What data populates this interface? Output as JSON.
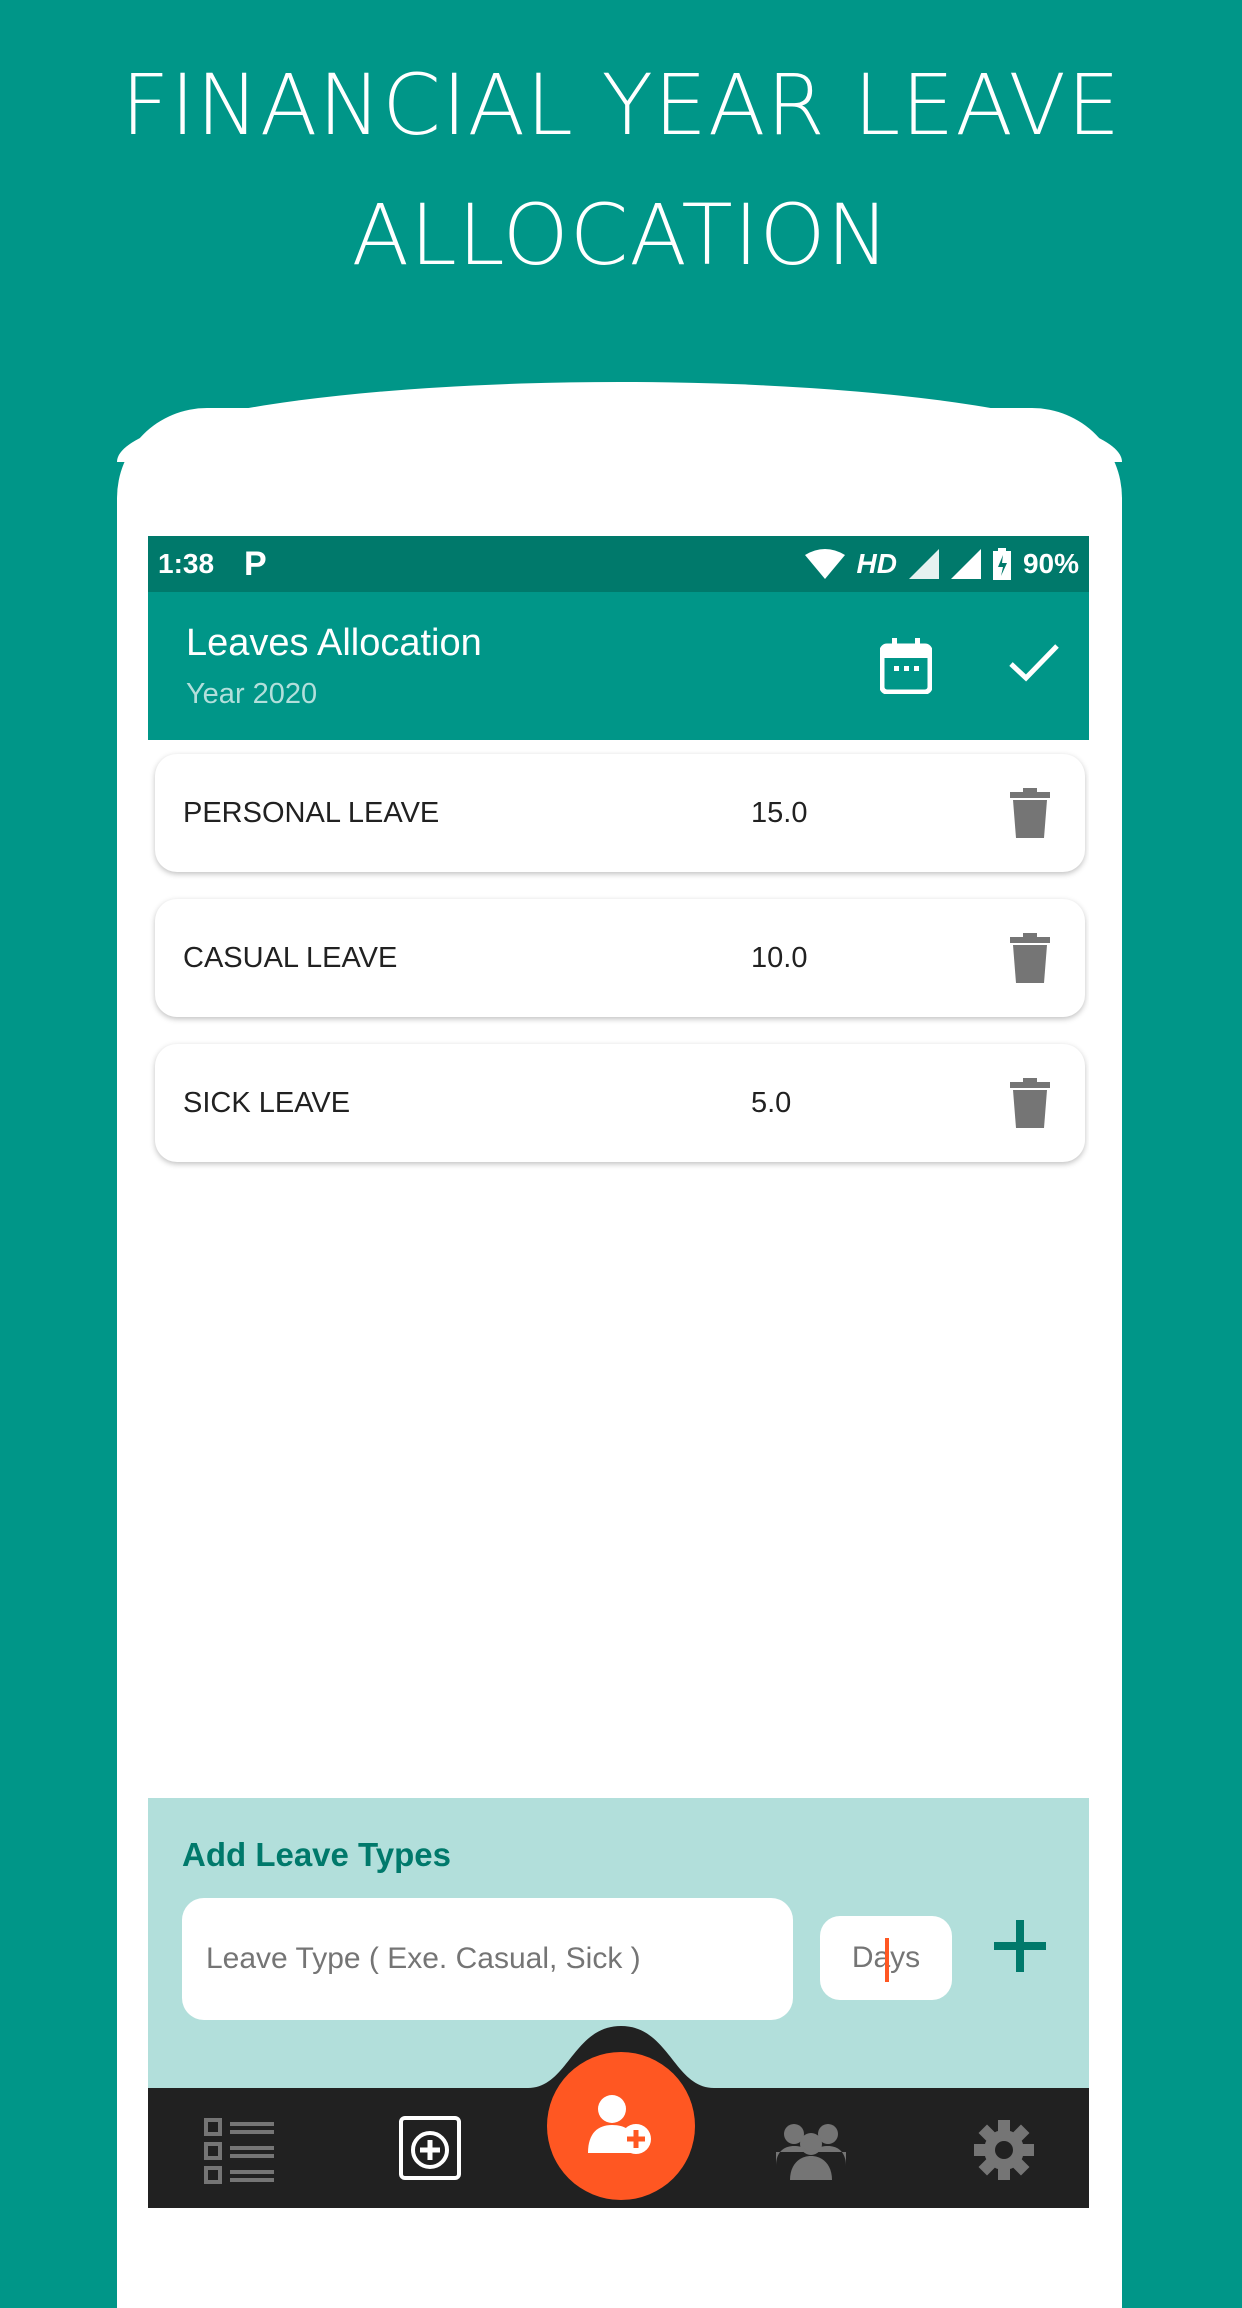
{
  "headline": {
    "line1": "FINANCIAL YEAR LEAVE",
    "line2": "ALLOCATION"
  },
  "status_bar": {
    "time": "1:38",
    "network": "HD",
    "battery": "90%"
  },
  "app_bar": {
    "title": "Leaves Allocation",
    "subtitle": "Year 2020"
  },
  "leaves": [
    {
      "name": "PERSONAL LEAVE",
      "days": "15.0"
    },
    {
      "name": "CASUAL LEAVE",
      "days": "10.0"
    },
    {
      "name": "SICK LEAVE",
      "days": "5.0"
    }
  ],
  "add_section": {
    "title": "Add Leave Types",
    "type_placeholder": "Leave Type ( Exe. Casual, Sick )",
    "days_placeholder": "Days"
  },
  "colors": {
    "primary": "#009688",
    "primary_dark": "#00796b",
    "accent": "#ff5722",
    "panel": "#b2dfdb",
    "nav": "#212121"
  },
  "nav": [
    "checklist-icon",
    "calendar-add-icon",
    "add-user-icon",
    "group-icon",
    "settings-icon"
  ]
}
